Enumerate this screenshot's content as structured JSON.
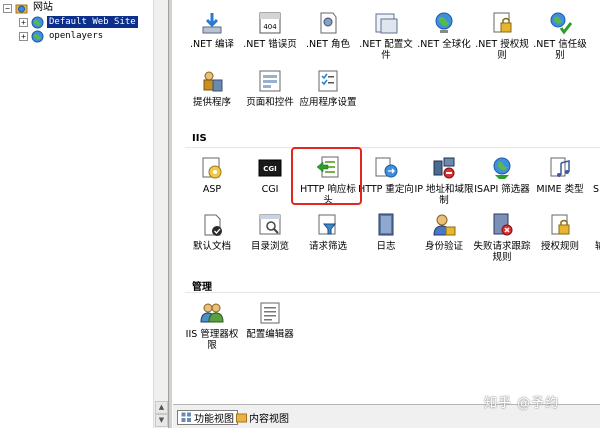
{
  "tree": {
    "sites_label": "网站",
    "items": [
      {
        "label": "Default Web Site",
        "selected": true
      },
      {
        "label": "openlayers",
        "selected": false
      }
    ]
  },
  "sections": {
    "iis": "IIS",
    "management": "管理"
  },
  "features_aspnet": [
    {
      "label": ".NET 编译",
      "icon": "net-compile-icon"
    },
    {
      "label": ".NET 错误页",
      "icon": "net-error-pages-icon"
    },
    {
      "label": ".NET 角色",
      "icon": "net-roles-icon"
    },
    {
      "label": ".NET 配置文件",
      "icon": "net-profile-icon"
    },
    {
      "label": ".NET 全球化",
      "icon": "net-globalization-icon"
    },
    {
      "label": ".NET 授权规则",
      "icon": "net-authorization-icon"
    },
    {
      "label": ".NET 信任级别",
      "icon": "net-trust-levels-icon"
    },
    {
      "label": "提供程序",
      "icon": "providers-icon"
    },
    {
      "label": "页面和控件",
      "icon": "pages-controls-icon"
    },
    {
      "label": "应用程序设置",
      "icon": "app-settings-icon"
    }
  ],
  "features_iis": [
    {
      "label": "ASP",
      "icon": "asp-icon"
    },
    {
      "label": "CGI",
      "icon": "cgi-icon"
    },
    {
      "label": "HTTP 响应标头",
      "icon": "http-response-headers-icon"
    },
    {
      "label": "HTTP 重定向",
      "icon": "http-redirect-icon"
    },
    {
      "label": "IP 地址和域限制",
      "icon": "ip-domain-restrictions-icon"
    },
    {
      "label": "ISAPI 筛选器",
      "icon": "isapi-filters-icon"
    },
    {
      "label": "MIME 类型",
      "icon": "mime-types-icon"
    },
    {
      "label": "S",
      "icon": "partial-icon"
    },
    {
      "label": "默认文档",
      "icon": "default-document-icon"
    },
    {
      "label": "目录浏览",
      "icon": "directory-browsing-icon"
    },
    {
      "label": "请求筛选",
      "icon": "request-filtering-icon"
    },
    {
      "label": "日志",
      "icon": "logging-icon"
    },
    {
      "label": "身份验证",
      "icon": "authentication-icon"
    },
    {
      "label": "失败请求跟踪规则",
      "icon": "failed-request-tracing-icon"
    },
    {
      "label": "授权规则",
      "icon": "authorization-rules-icon"
    },
    {
      "label": "输",
      "icon": "partial-icon"
    }
  ],
  "features_management": [
    {
      "label": "IIS 管理器权限",
      "icon": "iis-manager-permissions-icon"
    },
    {
      "label": "配置编辑器",
      "icon": "configuration-editor-icon"
    }
  ],
  "bottom_tabs": {
    "features_view": "功能视图",
    "content_view": "内容视图"
  },
  "watermark": "知乎 @予约",
  "colors": {
    "selection": "#0b2f8a",
    "highlight": "#e0261f"
  }
}
